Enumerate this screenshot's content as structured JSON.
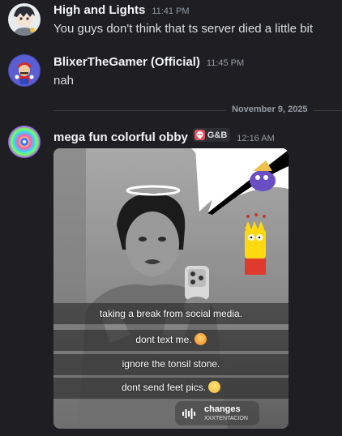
{
  "messages": [
    {
      "username": "High and Lights",
      "timestamp": "11:41 PM",
      "text": "You guys don't think that ts server died a little bit"
    },
    {
      "username": "BlixerTheGamer (Official)",
      "timestamp": "11:45 PM",
      "text": "nah"
    },
    {
      "username": "mega fun colorful obby",
      "tag": "G&B",
      "timestamp": "12:16 AM"
    }
  ],
  "date_divider": "November 9, 2025",
  "media": {
    "captions": [
      "taking a break from social media.",
      "dont text me.",
      "ignore the tonsil stone.",
      "dont send feet pics."
    ],
    "music": {
      "title": "changes",
      "artist": "XXXTENTACION"
    }
  },
  "colors": {
    "background": "#1f1f23",
    "username": "#f2f3f5",
    "timestamp": "#949ba4",
    "text": "#dbdee1"
  }
}
